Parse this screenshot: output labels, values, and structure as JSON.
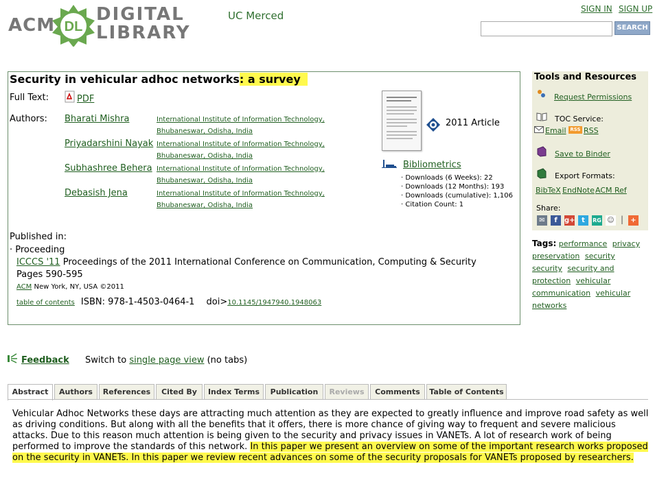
{
  "header": {
    "logo_acm": "ACM",
    "logo_dl": "DL",
    "logo_digital": "DIGITAL",
    "logo_library": "LIBRARY",
    "institution": "UC Merced",
    "sign_in": "SIGN IN",
    "sign_up": "SIGN UP",
    "search_value": "",
    "search_button": "SEARCH"
  },
  "article": {
    "title_plain": "Security in vehicular adhoc networks",
    "title_highlight": ": a survey",
    "full_text_label": "Full Text:",
    "pdf_label": "PDF",
    "authors_label": "Authors:",
    "authors": [
      {
        "name": "Bharati Mishra",
        "aff1": "International Institute of Information Technology,",
        "aff2": "Bhubaneswar, Odisha, India"
      },
      {
        "name": "Priyadarshini Nayak",
        "aff1": "International Institute of Information Technology,",
        "aff2": "Bhubaneswar, Odisha, India"
      },
      {
        "name": "Subhashree Behera",
        "aff1": "International Institute of Information Technology,",
        "aff2": "Bhubaneswar, Odisha, India"
      },
      {
        "name": "Debasish Jena",
        "aff1": "International Institute of Information Technology,",
        "aff2": "Bhubaneswar, Odisha, India"
      }
    ],
    "type": "2011 Article",
    "bibliometrics": "Bibliometrics",
    "stats": [
      "· Downloads (6 Weeks): 22",
      "· Downloads (12 Months): 193",
      "· Downloads (cumulative): 1,106",
      "· Citation Count: 1"
    ],
    "published_in": "Published in:",
    "proceeding": "· Proceeding",
    "conf_short": "ICCCS '11",
    "conf_long": "Proceedings of the 2011 International Conference on Communication, Computing & Security",
    "pages": "Pages 590-595",
    "publisher": "ACM",
    "publisher_loc": "New York, NY, USA ©2011",
    "toc": "table of contents",
    "isbn": "ISBN: 978-1-4503-0464-1",
    "doi_label": "doi>",
    "doi": "10.1145/1947940.1948063"
  },
  "sidebar": {
    "heading": "Tools and Resources",
    "request_permissions": "Request Permissions",
    "toc_service": "TOC Service:",
    "email": "Email",
    "rss_badge": "RSS",
    "rss": "RSS",
    "save_to_binder": "Save to Binder",
    "export_formats": "Export Formats:",
    "bibtex": "BibTeX",
    "endnote": "EndNote",
    "acm_ref": "ACM Ref",
    "share": "Share:",
    "tags_label": "Tags:",
    "tags": [
      "performance",
      "privacy preservation",
      "security",
      "security",
      "security and protection",
      "vehicular communication",
      "vehicular networks"
    ]
  },
  "feedback": {
    "label": "Feedback",
    "switch_prefix": "Switch to",
    "switch_link": "single page view",
    "switch_suffix": "(no tabs)"
  },
  "tabs": [
    "Abstract",
    "Authors",
    "References",
    "Cited By",
    "Index Terms",
    "Publication",
    "Reviews",
    "Comments",
    "Table of Contents"
  ],
  "abstract": {
    "plain": "Vehicular Adhoc Networks these days are attracting much attention as they are expected to greatly influence and improve road safety as well as driving conditions. But along with all the benefits that it offers, there is more chance of giving way to frequent and severe malicious attacks. Due to this reason much attention is being given to the security and privacy issues in VANETs. A lot of research work of being performed to improve the standards of this network. ",
    "highlight": "In this paper we present an overview on some of the important research works proposed on the security in VANETs. In this paper we review recent advances on some of the security proposals for VANETs proposed by researchers."
  },
  "colors": {
    "link": "#1f5e1f",
    "highlight": "#fff94d",
    "logo_green": "#6aa84f",
    "sidebar_bg": "#ededdc"
  }
}
